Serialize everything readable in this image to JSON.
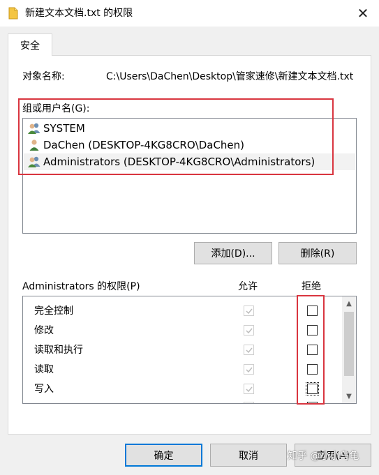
{
  "window": {
    "title": "新建文本文档.txt 的权限",
    "close_glyph": "✕"
  },
  "tabs": [
    {
      "label": "安全"
    }
  ],
  "object": {
    "label": "对象名称:",
    "value": "C:\\Users\\DaChen\\Desktop\\管家速修\\新建文本文档.txt"
  },
  "groups": {
    "label": "组或用户名(G):",
    "items": [
      {
        "name": "SYSTEM",
        "icon": "group-users-icon",
        "selected": false
      },
      {
        "name": "DaChen (DESKTOP-4KG8CRO\\DaChen)",
        "icon": "user-icon",
        "selected": false
      },
      {
        "name": "Administrators (DESKTOP-4KG8CRO\\Administrators)",
        "icon": "group-users-icon",
        "selected": true
      }
    ]
  },
  "buttons": {
    "add": "添加(D)...",
    "remove": "删除(R)",
    "ok": "确定",
    "cancel": "取消",
    "apply": "应用(A)"
  },
  "permissions": {
    "title": "Administrators 的权限(P)",
    "allow_header": "允许",
    "deny_header": "拒绝",
    "rows": [
      {
        "name": "完全控制",
        "allow": true,
        "allow_disabled": true,
        "deny": false
      },
      {
        "name": "修改",
        "allow": true,
        "allow_disabled": true,
        "deny": false
      },
      {
        "name": "读取和执行",
        "allow": true,
        "allow_disabled": true,
        "deny": false
      },
      {
        "name": "读取",
        "allow": true,
        "allow_disabled": true,
        "deny": false
      },
      {
        "name": "写入",
        "allow": true,
        "allow_disabled": true,
        "deny": false
      }
    ]
  },
  "watermark": "知乎 @小小乌龟",
  "colors": {
    "highlight_border": "#d9353f",
    "focus_border": "#0078d7",
    "disabled_check": "#bdbdbd"
  }
}
